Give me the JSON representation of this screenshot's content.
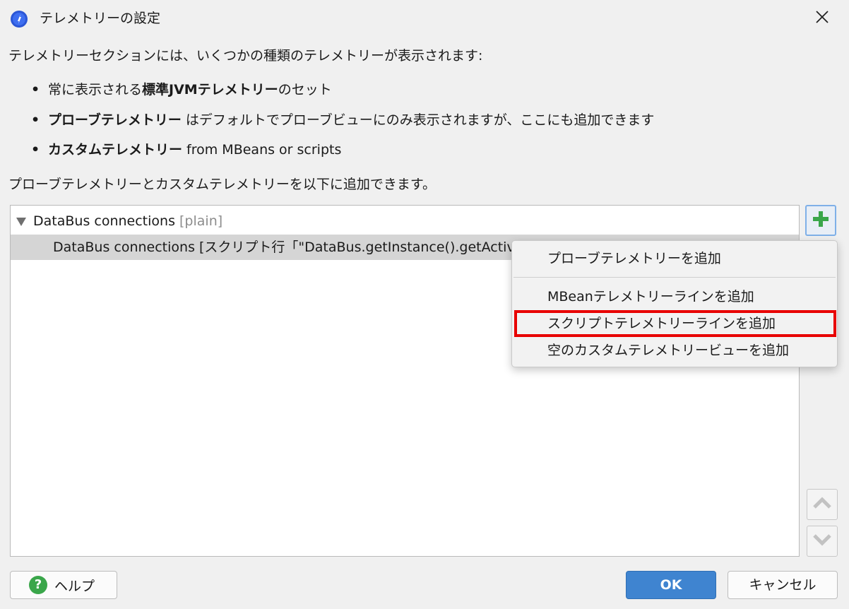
{
  "window": {
    "title": "テレメトリーの設定",
    "app_icon": "app-logo-icon",
    "close_icon": "close-icon"
  },
  "description": {
    "intro": "テレメトリーセクションには、いくつかの種類のテレメトリーが表示されます:",
    "bullets": [
      {
        "prefix": "常に表示される",
        "bold": "標準JVMテレメトリー",
        "suffix": "のセット"
      },
      {
        "prefix": "",
        "bold": "プローブテレメトリー",
        "suffix": " はデフォルトでプローブビューにのみ表示されますが、ここにも追加できます"
      },
      {
        "prefix": "",
        "bold": "カスタムテレメトリー",
        "suffix": " from MBeans or scripts"
      }
    ],
    "add_hint": "プローブテレメトリーとカスタムテレメトリーを以下に追加できます。"
  },
  "tree": {
    "items": [
      {
        "label": "DataBus connections",
        "tag": "[plain]",
        "expanded": true
      },
      {
        "label": "DataBus connections [スクリプト行「\"DataBus.getInstance().getActive"
      }
    ]
  },
  "popup_menu": {
    "items": [
      {
        "label": "プローブテレメトリーを追加"
      },
      {
        "label": "MBeanテレメトリーラインを追加"
      },
      {
        "label": "スクリプトテレメトリーラインを追加",
        "highlighted": true
      },
      {
        "label": "空のカスタムテレメトリービューを追加"
      }
    ],
    "highlight_color": "#e80000"
  },
  "side_buttons": {
    "add_icon": "plus-icon",
    "up_icon": "chevron-up-icon",
    "down_icon": "chevron-down-icon"
  },
  "footer": {
    "help_label": "ヘルプ",
    "ok_label": "OK",
    "cancel_label": "キャンセル"
  },
  "colors": {
    "accent": "#3f84d0",
    "add_green": "#3aa64a"
  }
}
